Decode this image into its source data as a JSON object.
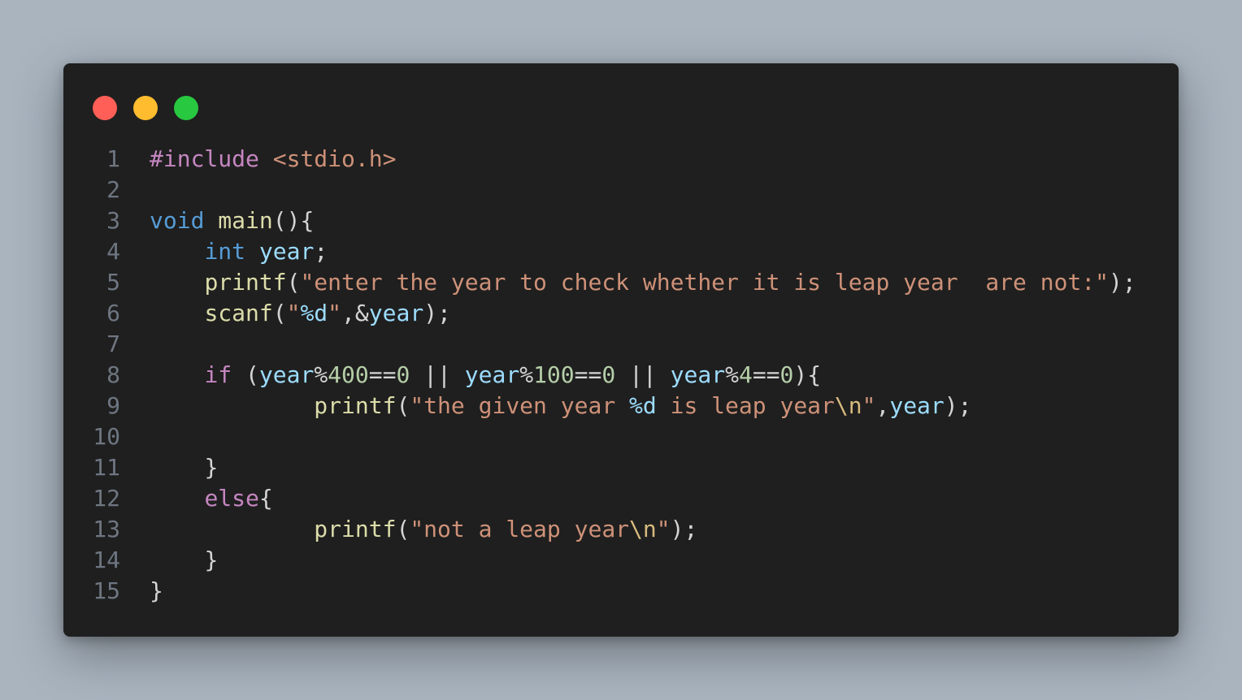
{
  "window_controls": [
    {
      "name": "close-button",
      "color": "#ff5f57"
    },
    {
      "name": "minimize-button",
      "color": "#febc2e"
    },
    {
      "name": "maximize-button",
      "color": "#28c840"
    }
  ],
  "colors": {
    "line_number": "#6e7681",
    "plain": "#d4d4d4",
    "keyword": "#c586c0",
    "type": "#569cd6",
    "function": "#dcdcaa",
    "variable": "#9cdcfe",
    "string": "#ce9178",
    "number": "#b5cea8",
    "format": "#9cdcfe",
    "escape": "#d7ba7d"
  },
  "code_lines": [
    {
      "n": "1",
      "tokens": [
        [
          "#include",
          "keyword"
        ],
        [
          " ",
          "plain"
        ],
        [
          "<stdio.h>",
          "string"
        ]
      ]
    },
    {
      "n": "2",
      "tokens": []
    },
    {
      "n": "3",
      "tokens": [
        [
          "void",
          "type"
        ],
        [
          " ",
          "plain"
        ],
        [
          "main",
          "function"
        ],
        [
          "(){",
          "plain"
        ]
      ]
    },
    {
      "n": "4",
      "tokens": [
        [
          "    ",
          "plain"
        ],
        [
          "int",
          "type"
        ],
        [
          " ",
          "plain"
        ],
        [
          "year",
          "variable"
        ],
        [
          ";",
          "plain"
        ]
      ]
    },
    {
      "n": "5",
      "tokens": [
        [
          "    ",
          "plain"
        ],
        [
          "printf",
          "function"
        ],
        [
          "(",
          "plain"
        ],
        [
          "\"enter the year to check whether it is leap year  are not:\"",
          "string"
        ],
        [
          ");",
          "plain"
        ]
      ]
    },
    {
      "n": "6",
      "tokens": [
        [
          "    ",
          "plain"
        ],
        [
          "scanf",
          "function"
        ],
        [
          "(",
          "plain"
        ],
        [
          "\"",
          "string"
        ],
        [
          "%d",
          "format"
        ],
        [
          "\"",
          "string"
        ],
        [
          ",&",
          "plain"
        ],
        [
          "year",
          "variable"
        ],
        [
          ");",
          "plain"
        ]
      ]
    },
    {
      "n": "7",
      "tokens": []
    },
    {
      "n": "8",
      "tokens": [
        [
          "    ",
          "plain"
        ],
        [
          "if",
          "keyword"
        ],
        [
          " (",
          "plain"
        ],
        [
          "year",
          "variable"
        ],
        [
          "%",
          "plain"
        ],
        [
          "400",
          "number"
        ],
        [
          "==",
          "plain"
        ],
        [
          "0",
          "number"
        ],
        [
          " || ",
          "plain"
        ],
        [
          "year",
          "variable"
        ],
        [
          "%",
          "plain"
        ],
        [
          "100",
          "number"
        ],
        [
          "==",
          "plain"
        ],
        [
          "0",
          "number"
        ],
        [
          " || ",
          "plain"
        ],
        [
          "year",
          "variable"
        ],
        [
          "%",
          "plain"
        ],
        [
          "4",
          "number"
        ],
        [
          "==",
          "plain"
        ],
        [
          "0",
          "number"
        ],
        [
          "){",
          "plain"
        ]
      ]
    },
    {
      "n": "9",
      "tokens": [
        [
          "            ",
          "plain"
        ],
        [
          "printf",
          "function"
        ],
        [
          "(",
          "plain"
        ],
        [
          "\"the given year ",
          "string"
        ],
        [
          "%d",
          "format"
        ],
        [
          " is leap year",
          "string"
        ],
        [
          "\\n",
          "escape"
        ],
        [
          "\"",
          "string"
        ],
        [
          ",",
          "plain"
        ],
        [
          "year",
          "variable"
        ],
        [
          ");",
          "plain"
        ]
      ]
    },
    {
      "n": "10",
      "tokens": []
    },
    {
      "n": "11",
      "tokens": [
        [
          "    ",
          "plain"
        ],
        [
          "}",
          "plain"
        ]
      ]
    },
    {
      "n": "12",
      "tokens": [
        [
          "    ",
          "plain"
        ],
        [
          "else",
          "keyword"
        ],
        [
          "{",
          "plain"
        ]
      ]
    },
    {
      "n": "13",
      "tokens": [
        [
          "            ",
          "plain"
        ],
        [
          "printf",
          "function"
        ],
        [
          "(",
          "plain"
        ],
        [
          "\"not a leap year",
          "string"
        ],
        [
          "\\n",
          "escape"
        ],
        [
          "\"",
          "string"
        ],
        [
          ");",
          "plain"
        ]
      ]
    },
    {
      "n": "14",
      "tokens": [
        [
          "    ",
          "plain"
        ],
        [
          "}",
          "plain"
        ]
      ]
    },
    {
      "n": "15",
      "tokens": [
        [
          "}",
          "plain"
        ]
      ]
    }
  ]
}
